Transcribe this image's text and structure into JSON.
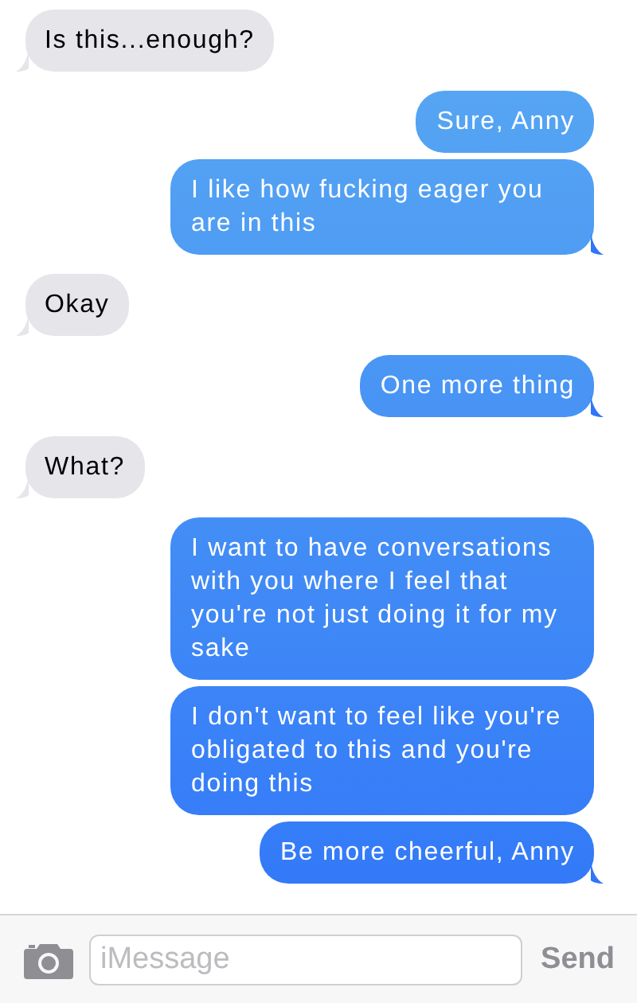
{
  "messages": [
    {
      "kind": "incoming",
      "text": "Is this...enough?",
      "tail": true
    },
    {
      "kind": "outgoing",
      "text": "Sure, Anny",
      "tail": false
    },
    {
      "kind": "outgoing",
      "text": "I like how fucking eager you are in this",
      "tail": true
    },
    {
      "kind": "incoming",
      "text": "Okay",
      "tail": true
    },
    {
      "kind": "outgoing",
      "text": "One more thing",
      "tail": true
    },
    {
      "kind": "incoming",
      "text": "What?",
      "tail": true
    },
    {
      "kind": "outgoing",
      "text": "I want to have conversations with you where I feel that you're not just doing it for my sake",
      "tail": false
    },
    {
      "kind": "outgoing",
      "text": "I don't want to feel like you're obligated to this and you're doing this",
      "tail": false
    },
    {
      "kind": "outgoing",
      "text": "Be more cheerful, Anny",
      "tail": true
    }
  ],
  "composer": {
    "placeholder": "iMessage",
    "send_label": "Send",
    "send_disabled": true
  }
}
